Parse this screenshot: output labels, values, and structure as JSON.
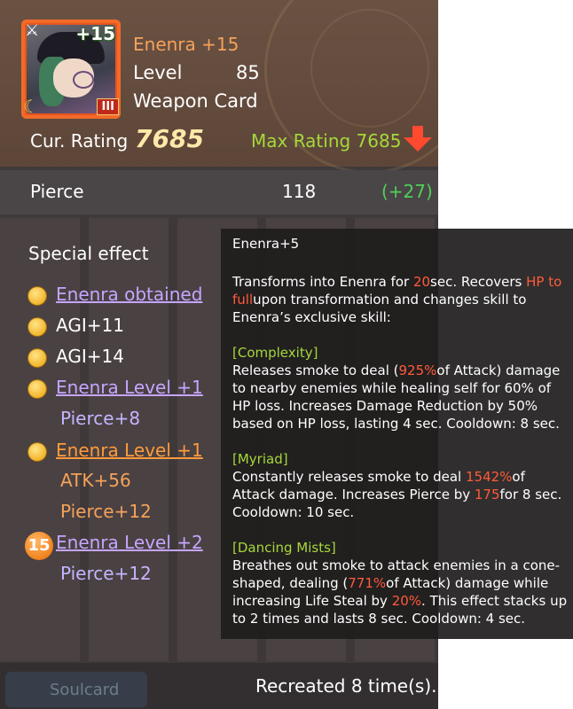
{
  "card": {
    "name": "Enenra +15",
    "level_label": "Level",
    "level_value": "85",
    "type": "Weapon Card",
    "portrait_plus": "+15",
    "portrait_tier": "III",
    "cur_rating_label": "Cur. Rating",
    "cur_rating_value": "7685",
    "max_rating_label": "Max Rating 7685"
  },
  "stat": {
    "label": "Pierce",
    "value": "118",
    "bonus": "(+27)"
  },
  "special_effect": {
    "title": "Special effect",
    "items": [
      {
        "text": "Enenra obtained"
      },
      {
        "text": "AGI+11"
      },
      {
        "text": "AGI+14"
      },
      {
        "text": "Enenra Level +1"
      },
      {
        "text": "Pierce+8"
      },
      {
        "text": "Enenra Level +1"
      },
      {
        "text": "ATK+56"
      },
      {
        "text": "Pierce+12"
      },
      {
        "text": "Enenra Level +2"
      },
      {
        "text": "Pierce+12"
      }
    ],
    "badge_15": "15"
  },
  "footer": {
    "soulcard": "Soulcard",
    "recreated": "Recreated 8 time(s)."
  },
  "tooltip": {
    "title": "Enenra+5",
    "intro_1": "Transforms into Enenra for ",
    "intro_20": "20",
    "intro_2": "sec. Recovers ",
    "intro_hp": "HP to full",
    "intro_3": "upon transformation and changes skill to Enenra’s exclusive skill:",
    "complexity_name": "[Complexity]",
    "complexity_1": "Releases smoke to deal (",
    "complexity_pct": "925%",
    "complexity_2": "of Attack) damage to nearby enemies while healing self for 60% of HP loss. Increases Damage Reduction by 50% based on HP loss, lasting 4 sec. Cooldown: 8 sec.",
    "myriad_name": "[Myriad]",
    "myriad_1": "Constantly releases smoke to deal ",
    "myriad_pct": "1542%",
    "myriad_2": "of Attack damage. Increases Pierce by ",
    "myriad_175": "175",
    "myriad_3": "for 8 sec. Cooldown: 10 sec.",
    "mists_name": "[Dancing Mists]",
    "mists_1": "Breathes out smoke to attack enemies in a cone-shaped, dealing (",
    "mists_pct": "771%",
    "mists_2": "of Attack) damage while increasing Life Steal by ",
    "mists_20": "20%",
    "mists_3": ". This effect stacks up to 2 times and lasts 8 sec. Cooldown: 4 sec."
  }
}
